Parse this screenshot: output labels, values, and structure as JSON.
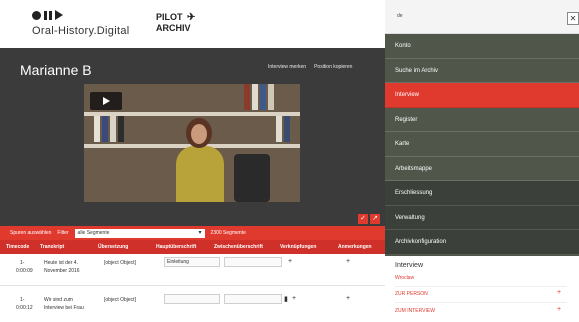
{
  "header": {
    "logo_text": "Oral-History.Digital",
    "pilot_line1": "PILOT",
    "pilot_line2": "ARCHIV",
    "plane_icon": "✈"
  },
  "stage": {
    "interviewee_name": "Marianne B",
    "chip1": "Interview merken",
    "chip2": "Position kopieren"
  },
  "filter": {
    "label": "Spuren auswählen",
    "filter_label": "Filter",
    "select_value": "alle Segmente",
    "count": "2300 Segmente"
  },
  "table": {
    "headers": [
      "Timecode",
      "Transkript",
      "Übersetzung",
      "Hauptüberschrift",
      "Zwischenüberschrift",
      "Verknüpfungen",
      "Anmerkungen"
    ],
    "rows": [
      {
        "tc1": "1-",
        "tc2": "0:00:09",
        "text1": "Heute ist der 4.",
        "text2": "November 2016",
        "object": "[object Object]",
        "heading": "Einleitung"
      },
      {
        "tc1": "1-",
        "tc2": "0:00:12",
        "text1": "Wir sind zum",
        "text2": "Interview bei Frau",
        "object": "[object Object]",
        "heading": ""
      }
    ]
  },
  "menu": {
    "lang": "de",
    "close": "✕",
    "items": [
      "Konto",
      "Suche im Archiv",
      "Interview",
      "Register",
      "Karte",
      "Arbeitsmappe",
      "Erschliessung",
      "Verwaltung",
      "Archivkonfiguration"
    ],
    "active_index": 2,
    "panel_title": "Interview",
    "panel_sub": "Wroclaw",
    "panel_link1": "ZUR PERSON",
    "panel_link2": "ZUM INTERVIEW"
  },
  "colors": {
    "accent": "#e03a2f",
    "menu_bg": "#50564a",
    "stage_bg": "#3b3b3b"
  }
}
